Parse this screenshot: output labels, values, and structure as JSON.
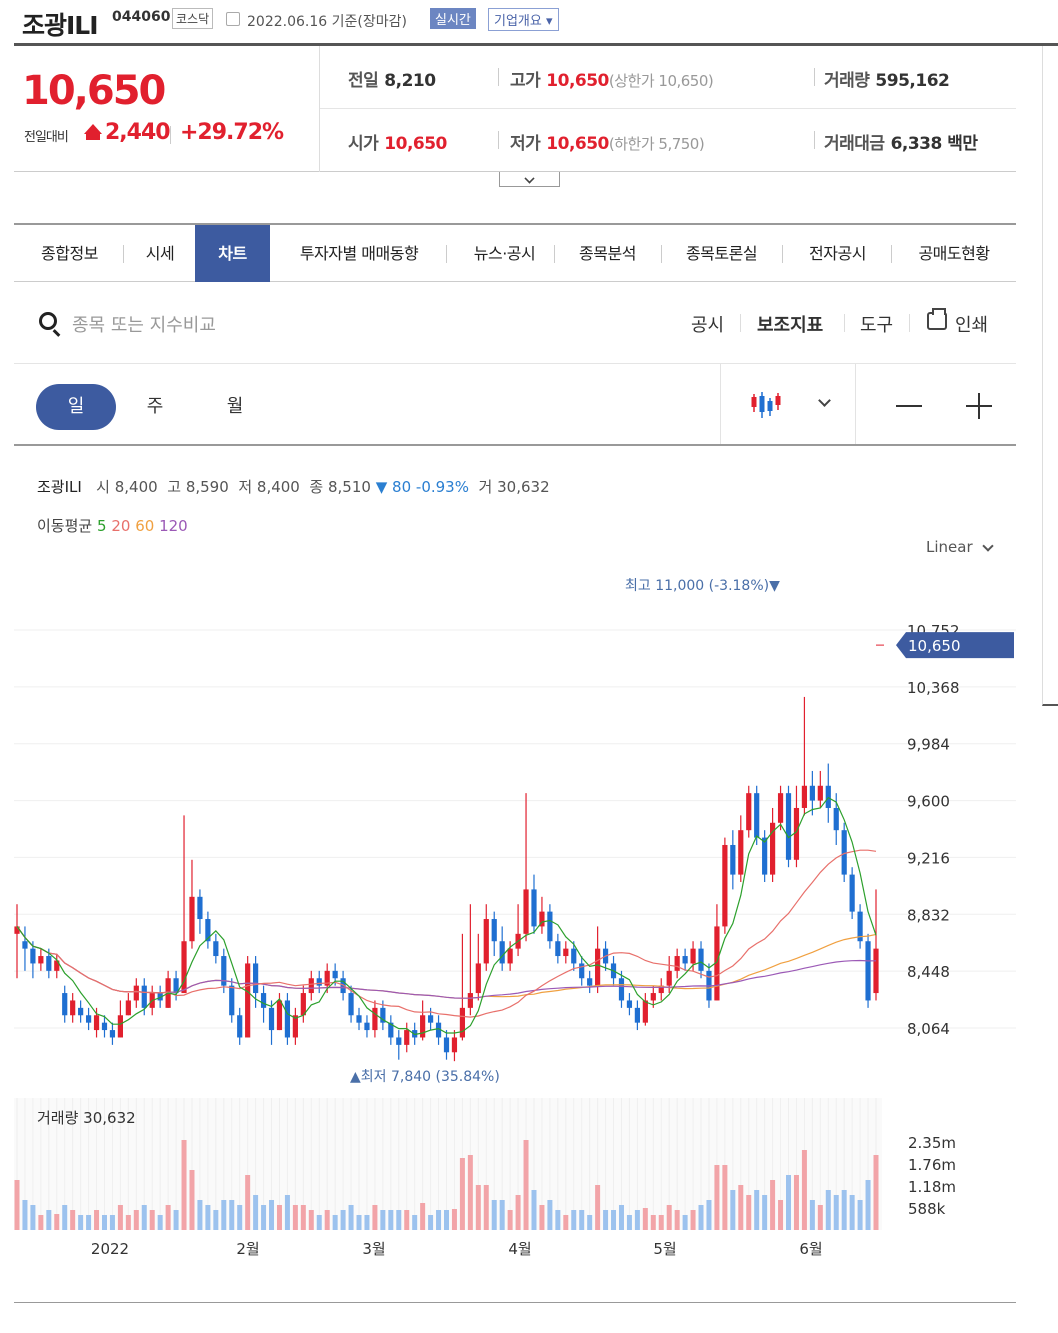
{
  "header": {
    "stock_name": "조광ILI",
    "code": "044060",
    "market": "코스닥",
    "date": "2022.06.16 기준(장마감)",
    "realtime_label": "실시간",
    "corp_label": "기업개요"
  },
  "quote": {
    "price": "10,650",
    "change_label": "전일대비",
    "change_value": "2,440",
    "change_pct": "+29.72%",
    "prev_close_label": "전일",
    "prev_close": "8,210",
    "high_label": "고가",
    "high": "10,650",
    "upper_limit": "(상한가 10,650)",
    "volume_label": "거래량",
    "volume": "595,162",
    "open_label": "시가",
    "open": "10,650",
    "low_label": "저가",
    "low": "10,650",
    "lower_limit": "(하한가 5,750)",
    "amount_label": "거래대금",
    "amount": "6,338",
    "amount_unit": "백만"
  },
  "tabs": [
    "종합정보",
    "시세",
    "차트",
    "투자자별 매매동향",
    "뉴스·공시",
    "종목분석",
    "종목토론실",
    "전자공시",
    "공매도현황"
  ],
  "active_tab": "차트",
  "toolbar": {
    "search_placeholder": "종목 또는 지수비교",
    "disclosure": "공시",
    "indicators": "보조지표",
    "tools": "도구",
    "print": "인쇄"
  },
  "periods": [
    "일",
    "주",
    "월"
  ],
  "info": {
    "name": "조광ILI",
    "open_lbl": "시",
    "open": "8,400",
    "high_lbl": "고",
    "high": "8,590",
    "low_lbl": "저",
    "low": "8,400",
    "close_lbl": "종",
    "close": "8,510",
    "change": "▼ 80",
    "pct": "-0.93%",
    "vol_lbl": "거",
    "vol": "30,632",
    "ma_label": "이동평균",
    "ma": [
      "5",
      "20",
      "60",
      "120"
    ]
  },
  "scale_label": "Linear",
  "colors": {
    "up": "#e1202e",
    "down": "#1f6fd1",
    "accent": "#3d5ba0",
    "ma5": "#2ca02c",
    "ma20": "#e8706b",
    "ma60": "#f0a040",
    "ma120": "#9b59b6"
  },
  "chart_data": {
    "type": "candlestick",
    "y_ticks": [
      "10,752",
      "10,368",
      "9,984",
      "9,600",
      "9,216",
      "8,832",
      "8,448",
      "8,064"
    ],
    "current_price_label": "10,650",
    "max_label": "최고 11,000 (-3.18%)▼",
    "min_label": "▲최저 7,840 (35.84%)",
    "x_labels": [
      "2022",
      "2월",
      "3월",
      "4월",
      "5월",
      "6월"
    ],
    "volume_label": "거래량 30,632",
    "volume_ticks": [
      "2.35m",
      "1.76m",
      "1.18m",
      "588k"
    ],
    "candles": [
      [
        8700,
        8750,
        8400,
        8900
      ],
      [
        8650,
        8600,
        8450,
        8750
      ],
      [
        8600,
        8500,
        8400,
        8650
      ],
      [
        8500,
        8550,
        8450,
        8600
      ],
      [
        8550,
        8450,
        8400,
        8600
      ],
      [
        8450,
        8520,
        8400,
        8560
      ],
      [
        8300,
        8150,
        8100,
        8350
      ],
      [
        8150,
        8250,
        8100,
        8300
      ],
      [
        8200,
        8150,
        8100,
        8250
      ],
      [
        8150,
        8100,
        8050,
        8200
      ],
      [
        8050,
        8150,
        8000,
        8200
      ],
      [
        8100,
        8050,
        8000,
        8150
      ],
      [
        8050,
        8000,
        7950,
        8100
      ],
      [
        8000,
        8150,
        8000,
        8250
      ],
      [
        8150,
        8250,
        8150,
        8300
      ],
      [
        8250,
        8350,
        8200,
        8400
      ],
      [
        8350,
        8200,
        8150,
        8400
      ],
      [
        8200,
        8300,
        8150,
        8350
      ],
      [
        8300,
        8250,
        8200,
        8350
      ],
      [
        8200,
        8400,
        8200,
        8450
      ],
      [
        8400,
        8300,
        8250,
        8450
      ],
      [
        8300,
        8650,
        8300,
        9500
      ],
      [
        8650,
        8950,
        8600,
        9200
      ],
      [
        8950,
        8800,
        8700,
        9000
      ],
      [
        8800,
        8650,
        8600,
        8850
      ],
      [
        8650,
        8550,
        8500,
        8700
      ],
      [
        8550,
        8350,
        8300,
        8600
      ],
      [
        8350,
        8150,
        8100,
        8400
      ],
      [
        8150,
        8000,
        7950,
        8200
      ],
      [
        8000,
        8500,
        8000,
        8550
      ],
      [
        8500,
        8300,
        8200,
        8550
      ],
      [
        8300,
        8200,
        8100,
        8350
      ],
      [
        8200,
        8050,
        7950,
        8250
      ],
      [
        8050,
        8250,
        8050,
        8300
      ],
      [
        8250,
        8000,
        7950,
        8300
      ],
      [
        8000,
        8150,
        7950,
        8200
      ],
      [
        8150,
        8300,
        8100,
        8350
      ],
      [
        8300,
        8400,
        8250,
        8450
      ],
      [
        8400,
        8350,
        8300,
        8450
      ],
      [
        8350,
        8450,
        8300,
        8500
      ],
      [
        8450,
        8400,
        8350,
        8500
      ],
      [
        8400,
        8300,
        8250,
        8450
      ],
      [
        8300,
        8150,
        8100,
        8350
      ],
      [
        8150,
        8100,
        8050,
        8200
      ],
      [
        8100,
        8050,
        8000,
        8150
      ],
      [
        8050,
        8200,
        8000,
        8250
      ],
      [
        8200,
        8100,
        8050,
        8250
      ],
      [
        8100,
        8000,
        7950,
        8150
      ],
      [
        8000,
        7950,
        7850,
        8050
      ],
      [
        7950,
        8050,
        7900,
        8100
      ],
      [
        8050,
        8000,
        7950,
        8100
      ],
      [
        8000,
        8150,
        7980,
        8250
      ],
      [
        8150,
        8100,
        8050,
        8200
      ],
      [
        8100,
        8000,
        7950,
        8150
      ],
      [
        8000,
        7900,
        7850,
        8050
      ],
      [
        7900,
        8000,
        7840,
        8050
      ],
      [
        8000,
        8200,
        7980,
        8700
      ],
      [
        8200,
        8300,
        8150,
        8900
      ],
      [
        8300,
        8500,
        8250,
        8700
      ],
      [
        8500,
        8800,
        8450,
        8900
      ],
      [
        8800,
        8650,
        8550,
        8850
      ],
      [
        8650,
        8500,
        8450,
        8750
      ],
      [
        8500,
        8600,
        8450,
        8650
      ],
      [
        8600,
        8700,
        8550,
        8900
      ],
      [
        8700,
        9000,
        8650,
        9650
      ],
      [
        9000,
        8750,
        8700,
        9100
      ],
      [
        8750,
        8850,
        8700,
        8950
      ],
      [
        8850,
        8650,
        8600,
        8900
      ],
      [
        8650,
        8550,
        8500,
        8700
      ],
      [
        8550,
        8600,
        8500,
        8650
      ],
      [
        8600,
        8500,
        8450,
        8650
      ],
      [
        8500,
        8400,
        8350,
        8550
      ],
      [
        8400,
        8350,
        8300,
        8450
      ],
      [
        8350,
        8600,
        8300,
        8750
      ],
      [
        8600,
        8500,
        8450,
        8650
      ],
      [
        8500,
        8400,
        8350,
        8550
      ],
      [
        8400,
        8250,
        8200,
        8450
      ],
      [
        8250,
        8200,
        8150,
        8300
      ],
      [
        8200,
        8100,
        8050,
        8250
      ],
      [
        8100,
        8250,
        8080,
        8300
      ],
      [
        8250,
        8300,
        8200,
        8350
      ],
      [
        8300,
        8350,
        8250,
        8400
      ],
      [
        8350,
        8450,
        8300,
        8550
      ],
      [
        8450,
        8550,
        8400,
        8600
      ],
      [
        8550,
        8500,
        8450,
        8600
      ],
      [
        8500,
        8600,
        8450,
        8650
      ],
      [
        8600,
        8450,
        8400,
        8650
      ],
      [
        8450,
        8250,
        8200,
        8500
      ],
      [
        8250,
        8750,
        8250,
        8900
      ],
      [
        8750,
        9300,
        8700,
        9350
      ],
      [
        9300,
        9100,
        9000,
        9400
      ],
      [
        9100,
        9400,
        9050,
        9500
      ],
      [
        9400,
        9650,
        9350,
        9700
      ],
      [
        9650,
        9350,
        9300,
        9700
      ],
      [
        9350,
        9100,
        9050,
        9400
      ],
      [
        9100,
        9450,
        9050,
        9550
      ],
      [
        9450,
        9650,
        9400,
        9700
      ],
      [
        9650,
        9200,
        9150,
        9700
      ],
      [
        9200,
        9550,
        9150,
        9700
      ],
      [
        9550,
        9700,
        9500,
        10300
      ],
      [
        9700,
        9600,
        9500,
        9800
      ],
      [
        9600,
        9700,
        9550,
        9800
      ],
      [
        9700,
        9550,
        9450,
        9850
      ],
      [
        9550,
        9400,
        9300,
        9650
      ],
      [
        9400,
        9100,
        9050,
        9450
      ],
      [
        9100,
        8850,
        8800,
        9150
      ],
      [
        8850,
        8650,
        8600,
        8900
      ],
      [
        8650,
        8250,
        8200,
        8700
      ],
      [
        8300,
        8600,
        8250,
        9000
      ]
    ]
  }
}
